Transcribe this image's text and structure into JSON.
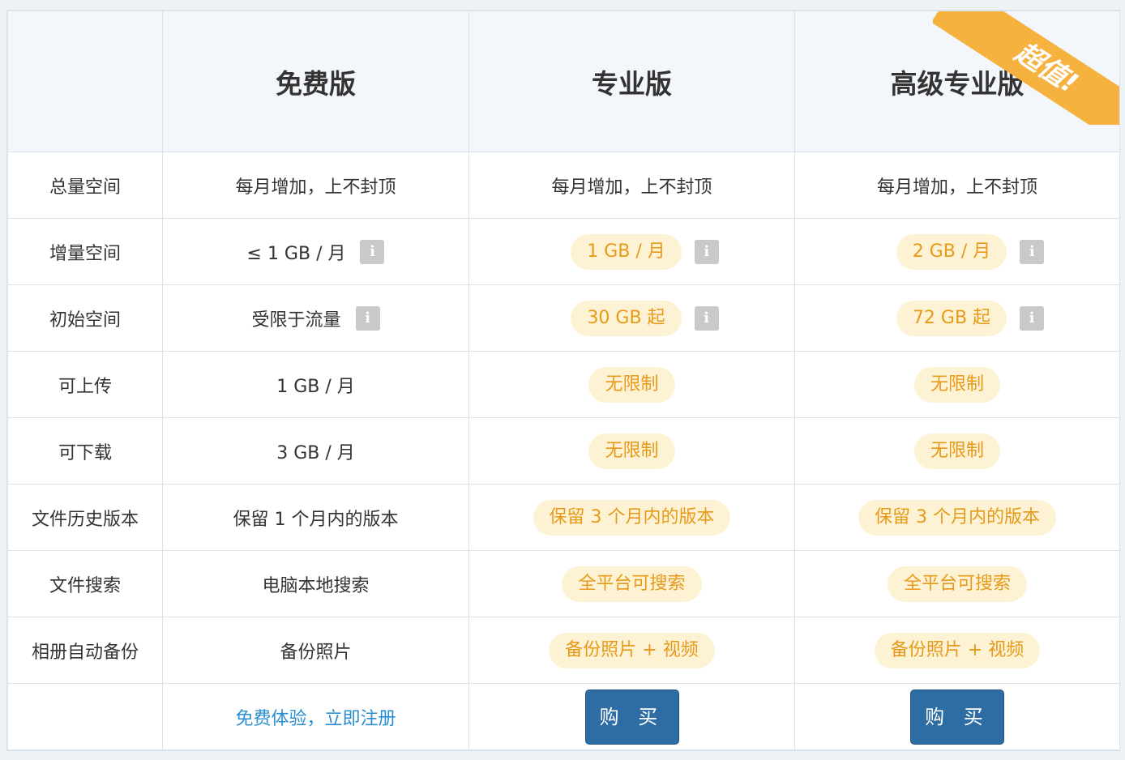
{
  "plans": [
    "免费版",
    "专业版",
    "高级专业版"
  ],
  "ribbon": "超值!",
  "rows": [
    {
      "label": "总量空间",
      "free": "每月增加，上不封顶",
      "pro": "每月增加，上不封顶",
      "premium": "每月增加，上不封顶"
    },
    {
      "label": "增量空间",
      "free": "≤ 1 GB / 月",
      "pro": "1 GB / 月",
      "premium": "2 GB / 月"
    },
    {
      "label": "初始空间",
      "free": "受限于流量",
      "pro": "30 GB 起",
      "premium": "72 GB 起"
    },
    {
      "label": "可上传",
      "free": "1 GB / 月",
      "pro": "无限制",
      "premium": "无限制"
    },
    {
      "label": "可下载",
      "free": "3 GB / 月",
      "pro": "无限制",
      "premium": "无限制"
    },
    {
      "label": "文件历史版本",
      "free": "保留 1 个月内的版本",
      "pro": "保留 3 个月内的版本",
      "premium": "保留 3 个月内的版本"
    },
    {
      "label": "文件搜索",
      "free": "电脑本地搜索",
      "pro": "全平台可搜索",
      "premium": "全平台可搜索"
    },
    {
      "label": "相册自动备份",
      "free": "备份照片",
      "pro": "备份照片 + 视频",
      "premium": "备份照片 + 视频"
    }
  ],
  "footer": {
    "free_link": "免费体验，立即注册",
    "buy_label": "购 买"
  },
  "info_glyph": "i",
  "colors": {
    "pill_bg": "#fdf3d4",
    "pill_text": "#e79a1a",
    "ribbon": "#f6b23f",
    "buy": "#2e6da4",
    "link": "#2a8fd0",
    "header_bg": "#f3f7fb"
  }
}
